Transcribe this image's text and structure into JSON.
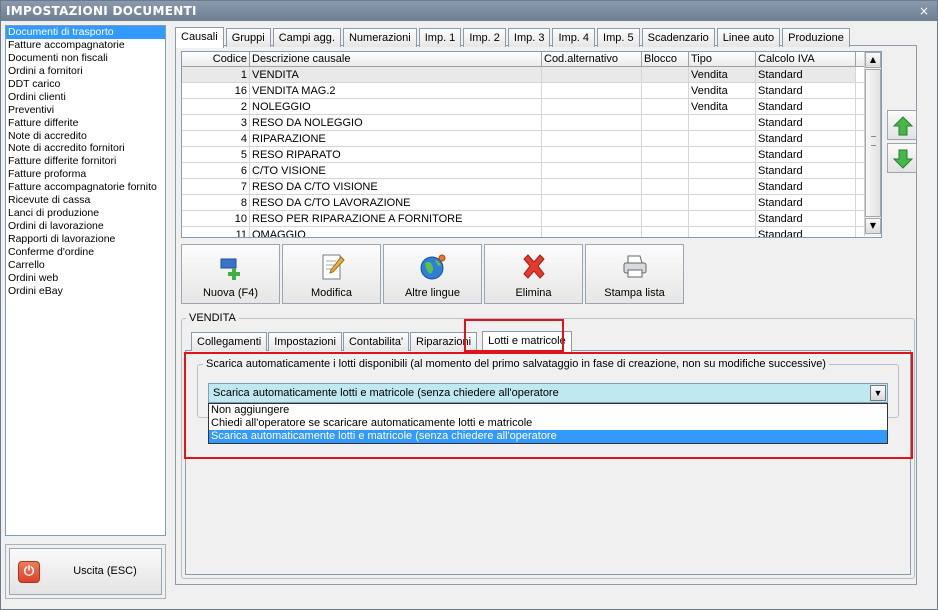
{
  "window": {
    "title": "IMPOSTAZIONI DOCUMENTI",
    "close_label": "×"
  },
  "sidebar": {
    "items": [
      "Documenti di trasporto",
      "Fatture accompagnatorie",
      "Documenti non fiscali",
      "Ordini a fornitori",
      "DDT carico",
      "Ordini clienti",
      "Preventivi",
      "Fatture differite",
      "Note di accredito",
      "Note di accredito fornitori",
      "Fatture differite fornitori",
      "Fatture proforma",
      "Fatture accompagnatorie fornito",
      "Ricevute di cassa",
      "Lanci di produzione",
      "Ordini di lavorazione",
      "Rapporti di lavorazione",
      "Conferme d'ordine",
      "Carrello",
      "Ordini web",
      "Ordini eBay"
    ],
    "selected_index": 0
  },
  "exit_button": {
    "label": "Uscita (ESC)",
    "icon": "power-icon"
  },
  "main_tabs": [
    "Causali",
    "Gruppi",
    "Campi agg.",
    "Numerazioni",
    "Imp. 1",
    "Imp. 2",
    "Imp. 3",
    "Imp. 4",
    "Imp. 5",
    "Scadenzario",
    "Linee auto",
    "Produzione"
  ],
  "main_tab_active": "Causali",
  "grid": {
    "columns": [
      "Codice",
      "Descrizione causale",
      "Cod.alternativo",
      "Blocco",
      "Tipo",
      "Calcolo IVA"
    ],
    "rows": [
      [
        "1",
        "VENDITA",
        "",
        "",
        "Vendita",
        "Standard"
      ],
      [
        "16",
        "VENDITA MAG.2",
        "",
        "",
        "Vendita",
        "Standard"
      ],
      [
        "2",
        "NOLEGGIO",
        "",
        "",
        "Vendita",
        "Standard"
      ],
      [
        "3",
        "RESO DA NOLEGGIO",
        "",
        "",
        "",
        "Standard"
      ],
      [
        "4",
        "RIPARAZIONE",
        "",
        "",
        "",
        "Standard"
      ],
      [
        "5",
        "RESO RIPARATO",
        "",
        "",
        "",
        "Standard"
      ],
      [
        "6",
        "C/TO VISIONE",
        "",
        "",
        "",
        "Standard"
      ],
      [
        "7",
        "RESO DA C/TO VISIONE",
        "",
        "",
        "",
        "Standard"
      ],
      [
        "8",
        "RESO DA C/TO LAVORAZIONE",
        "",
        "",
        "",
        "Standard"
      ],
      [
        "10",
        "RESO PER RIPARAZIONE A FORNITORE",
        "",
        "",
        "",
        "Standard"
      ],
      [
        "11",
        "OMAGGIO",
        "",
        "",
        "",
        "Standard"
      ]
    ],
    "selected_row": 0
  },
  "move_buttons": {
    "up_icon": "arrow-up-icon",
    "down_icon": "arrow-down-icon"
  },
  "toolbar": {
    "buttons": [
      {
        "label": "Nuova (F4)",
        "icon": "new-icon"
      },
      {
        "label": "Modifica",
        "icon": "edit-icon"
      },
      {
        "label": "Altre lingue",
        "icon": "globe-icon"
      },
      {
        "label": "Elimina",
        "icon": "delete-icon"
      },
      {
        "label": "Stampa lista",
        "icon": "printer-icon"
      }
    ]
  },
  "detail": {
    "group_label": "VENDITA",
    "tabs": [
      "Collegamenti",
      "Impostazioni",
      "Contabilita'",
      "Riparazioni",
      "Lotti e matricole"
    ],
    "active_tab": "Lotti e matricole",
    "field_label": "Scarica automaticamente i lotti disponibili (al momento del primo salvataggio in fase di creazione, non su modifiche successive)",
    "combo_value": "Scarica automaticamente lotti e matricole (senza chiedere all'operatore",
    "options": [
      "Non aggiungere",
      "Chiedi all'operatore se scaricare automaticamente lotti e matricole",
      "Scarica automaticamente lotti e matricole (senza chiedere all'operatore"
    ],
    "selected_option": 2
  },
  "colors": {
    "highlight": "#e0121a",
    "selection": "#3399ff",
    "combo_bg": "#bfe8f0"
  }
}
